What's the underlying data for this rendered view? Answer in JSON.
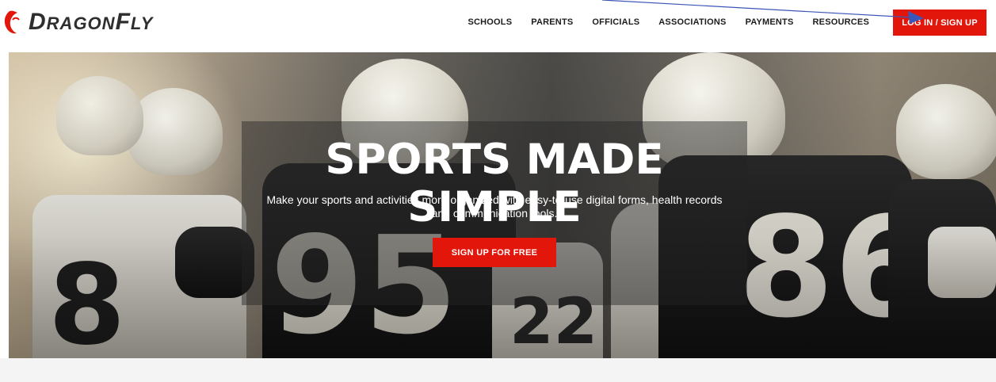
{
  "header": {
    "logo_text_big": "D",
    "logo_text_rest": "RAGON",
    "logo_text_big2": "F",
    "logo_text_rest2": "LY",
    "nav": [
      "SCHOOLS",
      "PARENTS",
      "OFFICIALS",
      "ASSOCIATIONS",
      "PAYMENTS",
      "RESOURCES"
    ],
    "login_label": "LOG IN / SIGN UP"
  },
  "hero": {
    "title": "SPORTS MADE SIMPLE",
    "subtitle": "Make your sports and activities more organized with easy-to-use digital forms, health records and communication tools.",
    "cta_label": "SIGN UP FOR FREE",
    "jersey_numbers": [
      "8",
      "95",
      "86",
      "22"
    ]
  },
  "colors": {
    "accent": "#e3160b",
    "nav_text": "#1d1d1d",
    "logo_text": "#2e2e2e",
    "annotation_arrow": "#3a56b8"
  },
  "icons": [
    "dragonfly-logo-icon",
    "annotation-arrow"
  ]
}
